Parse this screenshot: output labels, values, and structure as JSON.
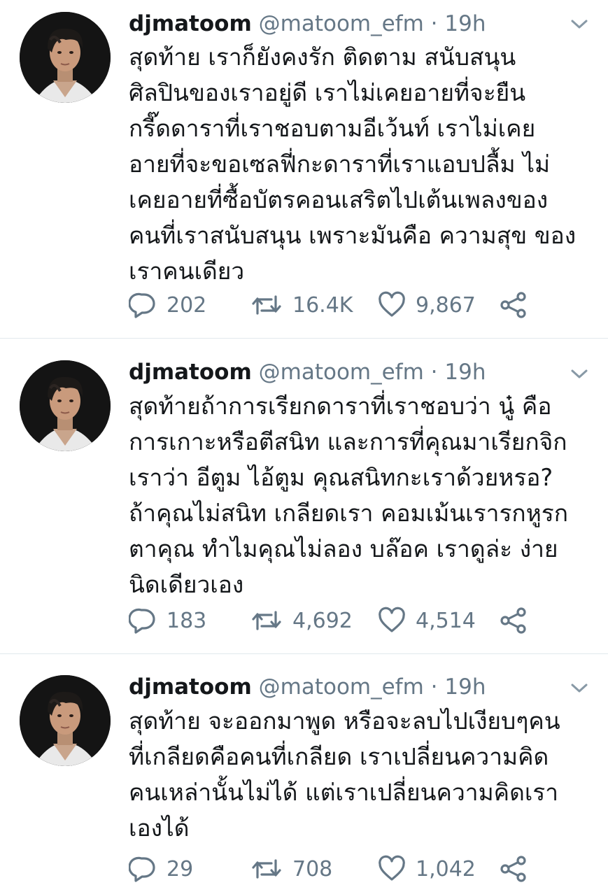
{
  "tweets": [
    {
      "display_name": "djmatoom",
      "handle": "@matoom_efm",
      "separator": "·",
      "time": "19h",
      "text": "สุดท้าย เราก็ยังคงรัก ติดตาม สนับสนุน\nศิลปินของเราอยู่ดี เราไม่เคยอายที่จะยืน\nกรี๊ดดาราที่เราชอบตามอีเว้นท์ เราไม่เคย\nอายที่จะขอเซลฟี่กะดาราที่เราแอบปลื้ม ไม่\nเคยอายที่ซื้อบัตรคอนเสริตไปเต้นเพลงของ\nคนที่เราสนับสนุน เพราะมันคือ ความสุข ของ\nเราคนเดียว",
      "replies": "202",
      "retweets": "16.4K",
      "likes": "9,867"
    },
    {
      "display_name": "djmatoom",
      "handle": "@matoom_efm",
      "separator": "·",
      "time": "19h",
      "text": "สุดท้ายถ้าการเรียกดาราที่เราชอบว่า นู๋ คือ\nการเกาะหรือตีสนิท และการที่คุณมาเรียกจิก\nเราว่า อีตูม ไอ้ตูม คุณสนิทกะเราด้วยหรอ?\nถ้าคุณไม่สนิท เกลียดเรา คอมเม้นเรารกหูรก\nตาคุณ ทำไมคุณไม่ลอง บล๊อค เราดูล่ะ ง่าย\nนิดเดียวเอง",
      "replies": "183",
      "retweets": "4,692",
      "likes": "4,514"
    },
    {
      "display_name": "djmatoom",
      "handle": "@matoom_efm",
      "separator": "·",
      "time": "19h",
      "text": "สุดท้าย จะออกมาพูด หรือจะลบไปเงียบๆคน\nที่เกลียดคือคนที่เกลียด เราเปลี่ยนความคิด\nคนเหล่านั้นไม่ได้ แต่เราเปลี่ยนความคิดเรา\nเองได้",
      "replies": "29",
      "retweets": "708",
      "likes": "1,042"
    }
  ],
  "icons": {
    "avatar": "profile-photo",
    "menu": "chevron-down-icon",
    "reply": "reply-icon",
    "retweet": "retweet-icon",
    "like": "heart-icon",
    "share": "share-icon"
  },
  "colors": {
    "text": "#14171a",
    "secondary": "#657786",
    "divider": "#e1e8ed"
  }
}
